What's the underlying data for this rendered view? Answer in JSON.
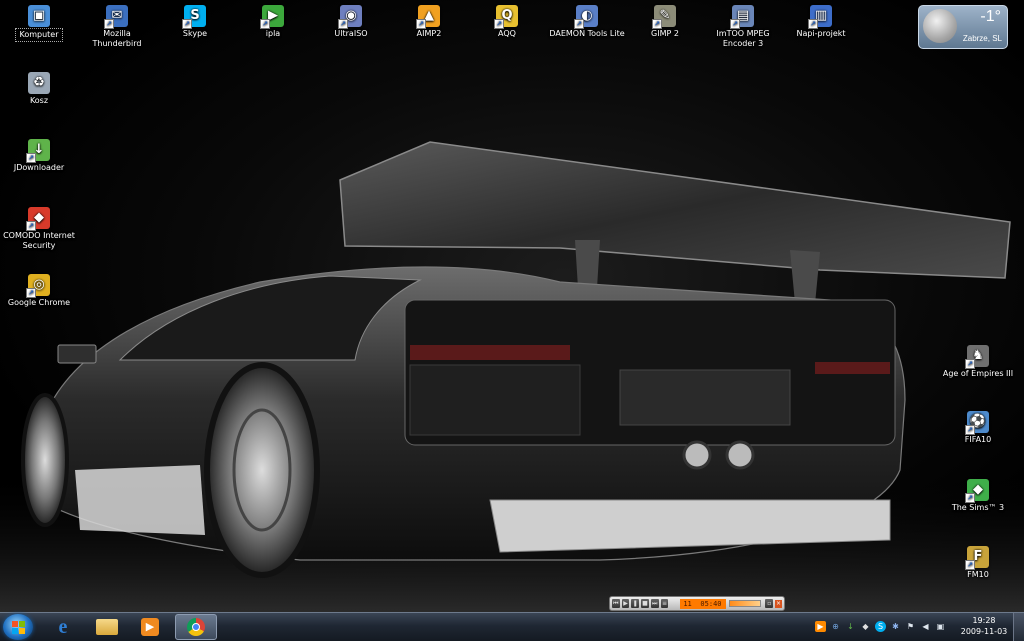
{
  "desktop": {
    "top_icons": [
      {
        "label": "Komputer",
        "icon": "computer-icon",
        "color": "#4a8fd8",
        "glyph": "▣"
      },
      {
        "label": "Mozilla\nThunderbird",
        "icon": "thunderbird-icon",
        "color": "#3b6fbf",
        "glyph": "✉"
      },
      {
        "label": "Skype",
        "icon": "skype-icon",
        "color": "#00aff0",
        "glyph": "S"
      },
      {
        "label": "ipla",
        "icon": "ipla-icon",
        "color": "#3ca83c",
        "glyph": "▶"
      },
      {
        "label": "UltraISO",
        "icon": "ultraiso-icon",
        "color": "#6e7fbf",
        "glyph": "◉"
      },
      {
        "label": "AIMP2",
        "icon": "aimp-icon",
        "color": "#f0a020",
        "glyph": "▲"
      },
      {
        "label": "AQQ",
        "icon": "aqq-icon",
        "color": "#e8c030",
        "glyph": "Q"
      },
      {
        "label": "DAEMON Tools Lite",
        "icon": "daemon-tools-icon",
        "color": "#5a7fc7",
        "glyph": "◐"
      },
      {
        "label": "GIMP 2",
        "icon": "gimp-icon",
        "color": "#8c8c78",
        "glyph": "✎"
      },
      {
        "label": "ImTOO MPEG\nEncoder 3",
        "icon": "imtoo-icon",
        "color": "#6a86b8",
        "glyph": "▤"
      },
      {
        "label": "Napi-projekt",
        "icon": "napi-projekt-icon",
        "color": "#3d6dc9",
        "glyph": "▥"
      }
    ],
    "left_icons": [
      {
        "label": "Kosz",
        "icon": "recycle-bin-icon",
        "color": "#9aa7b5",
        "glyph": "♻"
      },
      {
        "label": "JDownloader",
        "icon": "jdownloader-icon",
        "color": "#5fb34a",
        "glyph": "↓"
      },
      {
        "label": "COMODO Internet\nSecurity",
        "icon": "comodo-icon",
        "color": "#d83a2a",
        "glyph": "◆"
      },
      {
        "label": "Google Chrome",
        "icon": "chrome-icon",
        "color": "#e0b020",
        "glyph": "◎"
      }
    ],
    "right_icons": [
      {
        "label": "Age of Empires III",
        "icon": "aoe3-icon",
        "color": "#6f6f6f",
        "glyph": "♞"
      },
      {
        "label": "FIFA10",
        "icon": "fifa10-icon",
        "color": "#4d8acb",
        "glyph": "⚽"
      },
      {
        "label": "The Sims™ 3",
        "icon": "sims3-icon",
        "color": "#3fae4a",
        "glyph": "◆"
      },
      {
        "label": "FM10",
        "icon": "fm10-icon",
        "color": "#c8a33a",
        "glyph": "F"
      }
    ]
  },
  "weather": {
    "temp": "-1°",
    "city": "Zabrze, SL"
  },
  "player": {
    "time": "05:40",
    "track_no": "11"
  },
  "taskbar": {
    "pinned": [
      {
        "name": "internet-explorer-icon",
        "color": "#2f7fd6",
        "glyph": "e"
      },
      {
        "name": "explorer-folder-icon",
        "color": "#e8c060",
        "glyph": "▭"
      },
      {
        "name": "media-player-icon",
        "color": "#f08a20",
        "glyph": "▶"
      },
      {
        "name": "chrome-taskbar-icon",
        "color": "#d94b3a",
        "glyph": "◎"
      }
    ],
    "tray": [
      {
        "name": "aimp-tray-icon",
        "color": "#ff8a00",
        "glyph": "▶"
      },
      {
        "name": "network-search-icon",
        "color": "#6f9fd8",
        "glyph": "⊕"
      },
      {
        "name": "update-tray-icon",
        "color": "#61b44a",
        "glyph": "↓"
      },
      {
        "name": "shield-tray-icon",
        "color": "#e0e0e0",
        "glyph": "◆"
      },
      {
        "name": "skype-tray-icon",
        "color": "#00aff0",
        "glyph": "S"
      },
      {
        "name": "bluetooth-tray-icon",
        "color": "#3a6fc9",
        "glyph": "✱"
      },
      {
        "name": "action-center-flag-icon",
        "color": "#dfe6ee",
        "glyph": "⚑"
      },
      {
        "name": "volume-icon",
        "color": "#dfe6ee",
        "glyph": "◀"
      },
      {
        "name": "network-icon",
        "color": "#dfe6ee",
        "glyph": "▣"
      }
    ],
    "time": "19:28",
    "date": "2009-11-03"
  }
}
